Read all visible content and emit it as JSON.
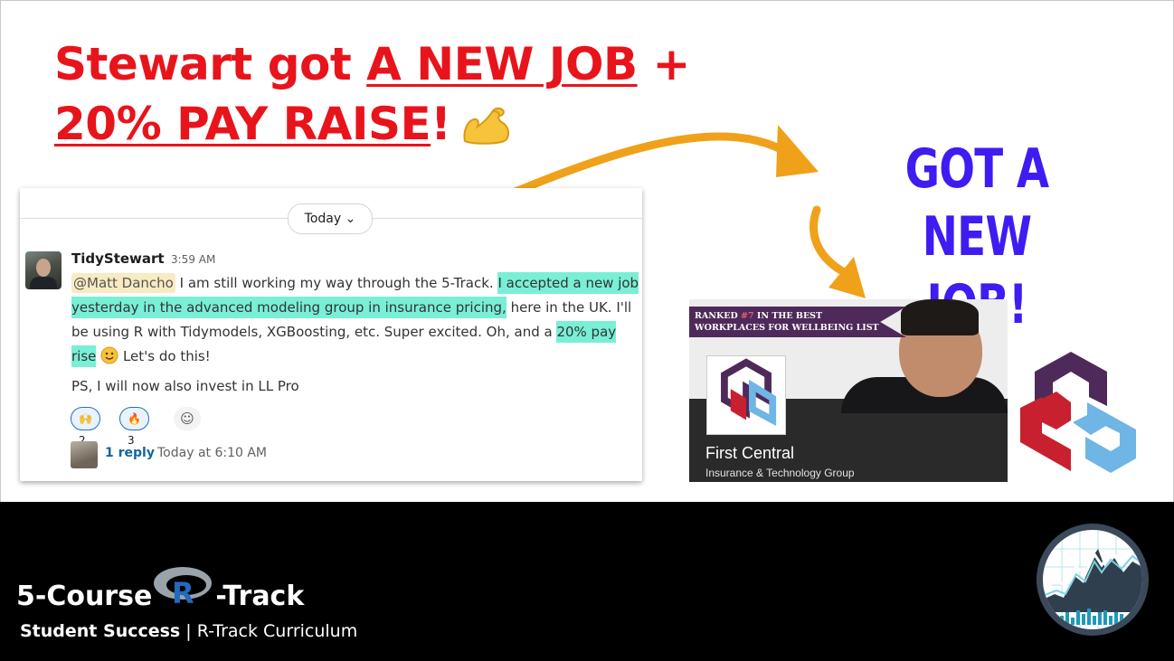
{
  "headline": {
    "prefix": "Stewart got ",
    "new_job": "A NEW JOB",
    "plus": " +",
    "raise": "20% PAY RAISE",
    "bang": "!"
  },
  "callout": {
    "line1": "GOT A NEW",
    "line2": "JOB!"
  },
  "slack": {
    "divider_label": "Today ⌄",
    "username": "TidyStewart",
    "time": "3:59 AM",
    "mention": "@Matt Dancho",
    "text1": " I am still working my way through the 5-Track. ",
    "hl1": " I accepted a new job yesterday in the advanced modeling group in insurance pricing,",
    "text2": " here in the UK. I'll be using R with Tidymodels, XGBoosting, etc.  Super excited. Oh, and a ",
    "hl2": "20% pay rise",
    "text3": " Let's do this!",
    "ps": "PS, I will now also invest in LL Pro",
    "reactions": [
      {
        "emoji": "🙌",
        "count": "2"
      },
      {
        "emoji": "🔥",
        "count": "3"
      }
    ],
    "add_reaction_icon": "☺",
    "reply_count": "1 reply",
    "reply_time": "Today at 6:10 AM"
  },
  "banner": {
    "ribbon_pre": "RANKED ",
    "ribbon_rank": "#7",
    "ribbon_post": " IN THE BEST WORKPLACES FOR WELLBEING LIST",
    "company": "First Central",
    "subtitle": "Insurance & Technology Group"
  },
  "footer": {
    "brand_left": "5-Course",
    "brand_right": "-Track",
    "r_letter": "R",
    "tag_bold": "Student Success",
    "tag_rest": " | R-Track Curriculum"
  },
  "colors": {
    "headline": "#e8141b",
    "callout": "#3f1cf2",
    "arrow": "#f0a11a",
    "highlight": "#79efd6",
    "mention": "#f8ebc2",
    "logo_purple": "#4e2a5a",
    "logo_red": "#c8202f",
    "logo_blue": "#6fb5e6"
  }
}
